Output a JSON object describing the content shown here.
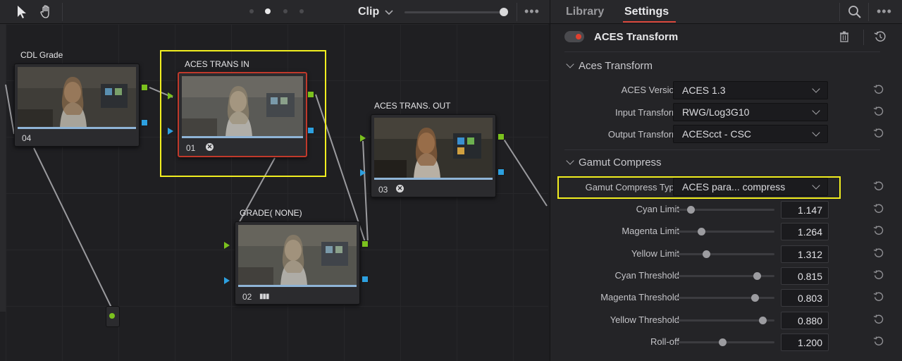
{
  "toolbar": {
    "clip_label": "Clip",
    "more_label": "•••"
  },
  "nodes": [
    {
      "id": "cdl",
      "title": "CDL Grade",
      "number": "04"
    },
    {
      "id": "aces_in",
      "title": "ACES TRANS IN",
      "number": "01"
    },
    {
      "id": "grade",
      "title": "GRADE( NONE)",
      "number": "02"
    },
    {
      "id": "aces_out",
      "title": "ACES TRANS. OUT",
      "number": "03"
    }
  ],
  "panel": {
    "tabs": [
      {
        "label": "Library",
        "active": false
      },
      {
        "label": "Settings",
        "active": true
      }
    ],
    "more_label": "•••",
    "effect_title": "ACES Transform",
    "enabled": true,
    "sections": {
      "aces_transform": {
        "title": "Aces Transform",
        "fields": [
          {
            "label": "ACES Version",
            "value": "ACES 1.3"
          },
          {
            "label": "Input Transform",
            "value": "RWG/Log3G10"
          },
          {
            "label": "Output Transform",
            "value": "ACEScct - CSC"
          }
        ]
      },
      "gamut_compress": {
        "title": "Gamut Compress",
        "type_field": {
          "label": "Gamut Compress Type",
          "value": "ACES para... compress"
        },
        "sliders": [
          {
            "label": "Cyan Limit",
            "value": "1.147",
            "fraction": 0.15
          },
          {
            "label": "Magenta Limit",
            "value": "1.264",
            "fraction": 0.26
          },
          {
            "label": "Yellow Limit",
            "value": "1.312",
            "fraction": 0.31
          },
          {
            "label": "Cyan Threshold",
            "value": "0.815",
            "fraction": 0.82
          },
          {
            "label": "Magenta Threshold",
            "value": "0.803",
            "fraction": 0.8
          },
          {
            "label": "Yellow Threshold",
            "value": "0.880",
            "fraction": 0.88
          },
          {
            "label": "Roll-off",
            "value": "1.200",
            "fraction": 0.47
          }
        ]
      }
    }
  },
  "colors": {
    "highlight": "#f1ee1f",
    "tab_underline": "#d8473c",
    "port_green": "#7bc11e",
    "port_blue": "#2da0e0",
    "selected_node_border": "#c0392b"
  }
}
